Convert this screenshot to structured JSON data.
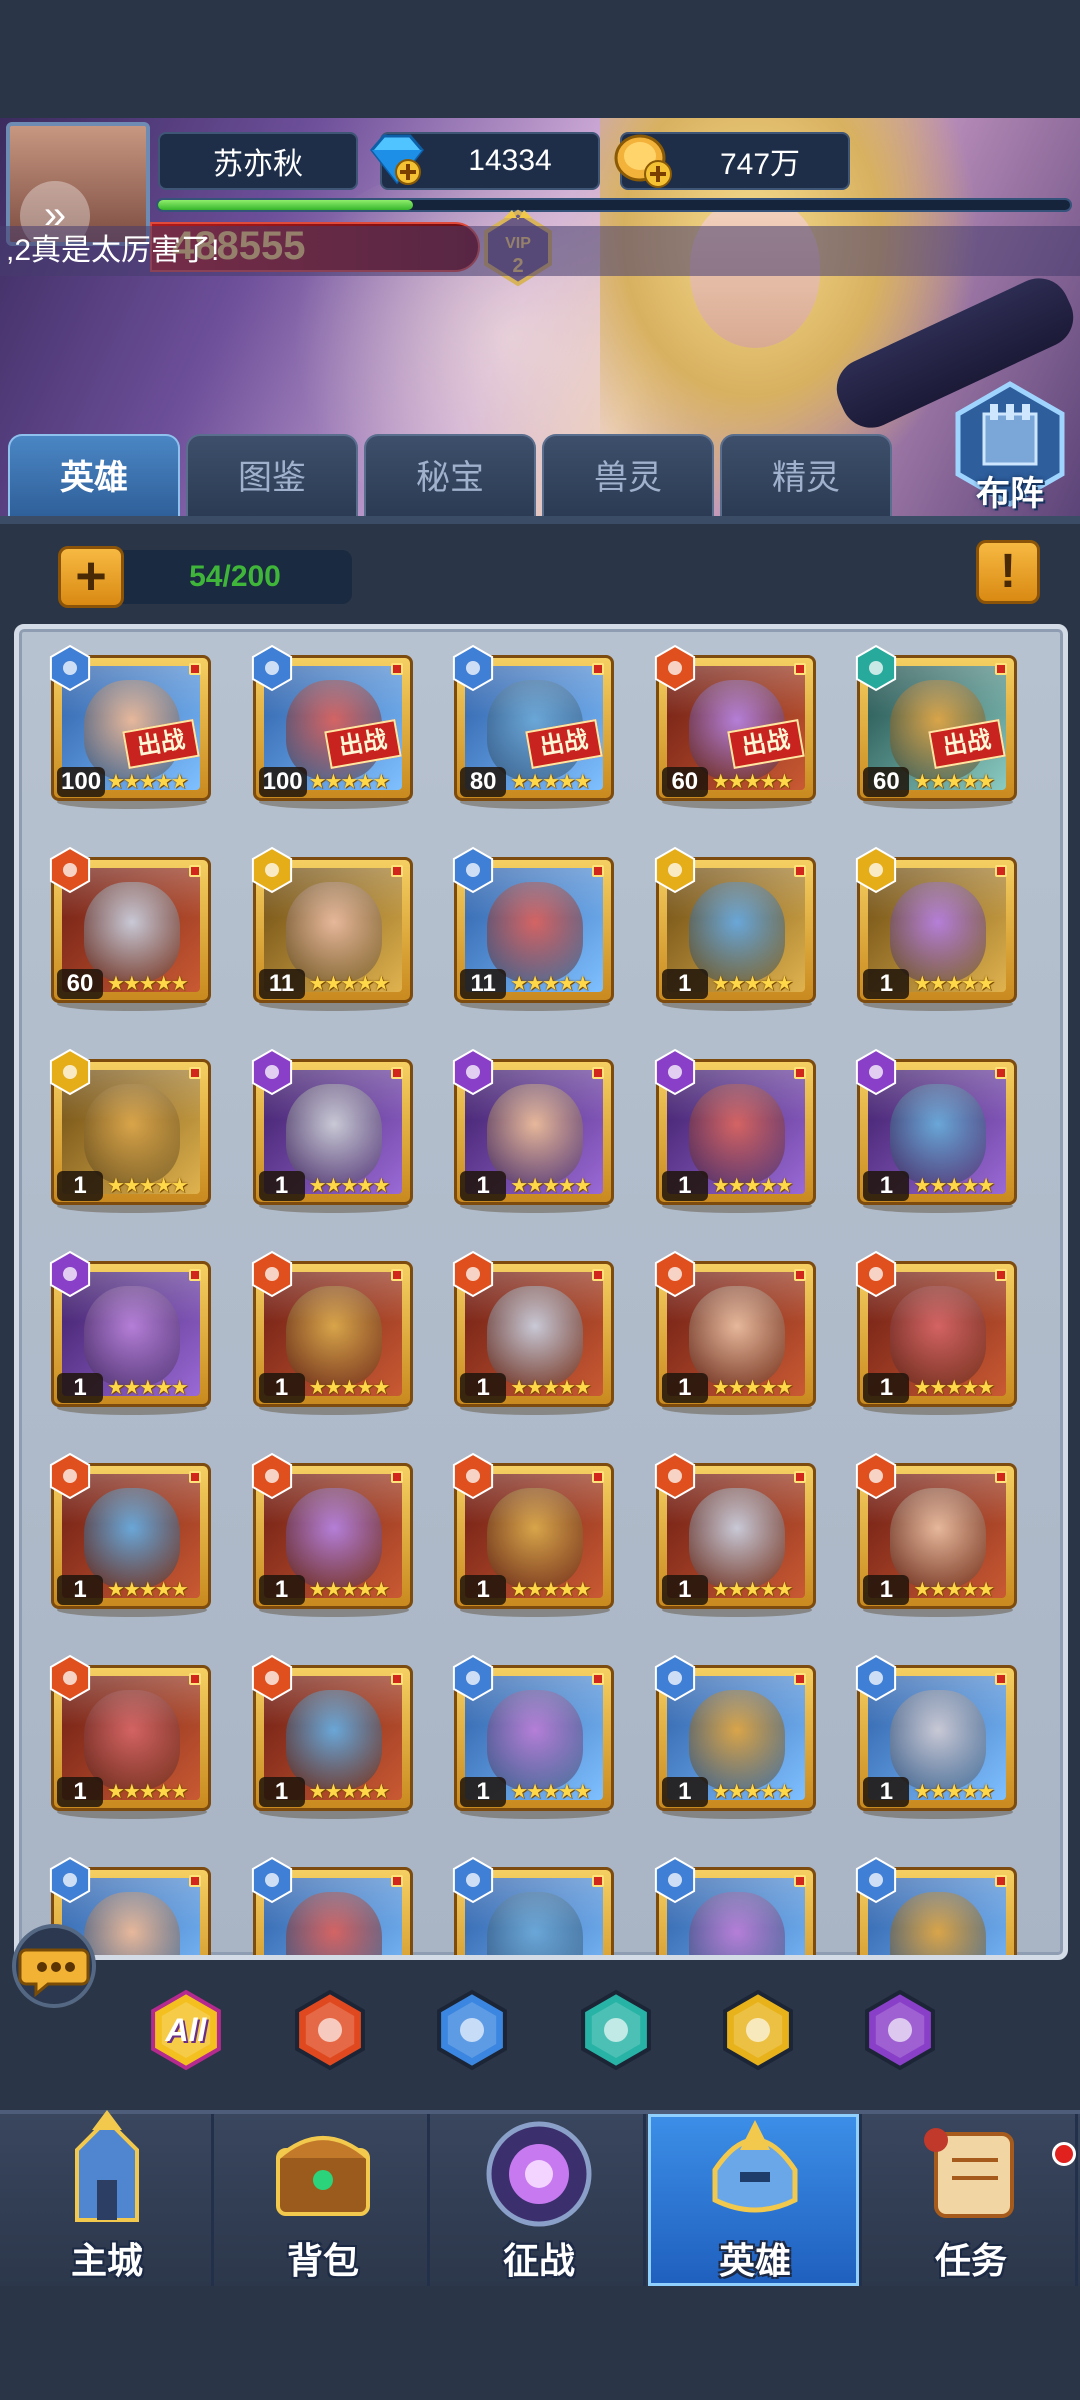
{
  "player": {
    "name": "苏亦秋",
    "diamonds": "14334",
    "gold": "747万",
    "power": "488555",
    "vip_level": "2",
    "xp_progress": 0.28
  },
  "chat_ticker": ",2真是太厉害了!",
  "formation_label": "布阵",
  "tabs": [
    {
      "label": "英雄",
      "active": true
    },
    {
      "label": "图鉴",
      "active": false
    },
    {
      "label": "秘宝",
      "active": false
    },
    {
      "label": "兽灵",
      "active": false
    },
    {
      "label": "精灵",
      "active": false
    }
  ],
  "inventory": {
    "count": "54/200",
    "add_label": "+",
    "info_label": "!"
  },
  "deploy_label": "出战",
  "heroes": [
    {
      "level": "100",
      "faction": "blue",
      "stars": 5,
      "deployed": true
    },
    {
      "level": "100",
      "faction": "blue",
      "stars": 5,
      "deployed": true
    },
    {
      "level": "80",
      "faction": "blue",
      "stars": 5,
      "deployed": true
    },
    {
      "level": "60",
      "faction": "red",
      "stars": 5,
      "deployed": true
    },
    {
      "level": "60",
      "faction": "teal",
      "stars": 5,
      "deployed": true
    },
    {
      "level": "60",
      "faction": "red",
      "stars": 5,
      "deployed": false
    },
    {
      "level": "11",
      "faction": "yellow",
      "stars": 5,
      "deployed": false
    },
    {
      "level": "11",
      "faction": "blue",
      "stars": 5,
      "deployed": false
    },
    {
      "level": "1",
      "faction": "yellow",
      "stars": 5,
      "deployed": false
    },
    {
      "level": "1",
      "faction": "yellow",
      "stars": 5,
      "deployed": false
    },
    {
      "level": "1",
      "faction": "yellow",
      "stars": 5,
      "deployed": false
    },
    {
      "level": "1",
      "faction": "purple",
      "stars": 5,
      "deployed": false
    },
    {
      "level": "1",
      "faction": "purple",
      "stars": 5,
      "deployed": false
    },
    {
      "level": "1",
      "faction": "purple",
      "stars": 5,
      "deployed": false
    },
    {
      "level": "1",
      "faction": "purple",
      "stars": 5,
      "deployed": false
    },
    {
      "level": "1",
      "faction": "purple",
      "stars": 5,
      "deployed": false
    },
    {
      "level": "1",
      "faction": "red",
      "stars": 5,
      "deployed": false
    },
    {
      "level": "1",
      "faction": "red",
      "stars": 5,
      "deployed": false
    },
    {
      "level": "1",
      "faction": "red",
      "stars": 5,
      "deployed": false
    },
    {
      "level": "1",
      "faction": "red",
      "stars": 5,
      "deployed": false
    },
    {
      "level": "1",
      "faction": "red",
      "stars": 5,
      "deployed": false
    },
    {
      "level": "1",
      "faction": "red",
      "stars": 5,
      "deployed": false
    },
    {
      "level": "1",
      "faction": "red",
      "stars": 5,
      "deployed": false
    },
    {
      "level": "1",
      "faction": "red",
      "stars": 5,
      "deployed": false
    },
    {
      "level": "1",
      "faction": "red",
      "stars": 5,
      "deployed": false
    },
    {
      "level": "1",
      "faction": "red",
      "stars": 5,
      "deployed": false
    },
    {
      "level": "1",
      "faction": "red",
      "stars": 5,
      "deployed": false
    },
    {
      "level": "1",
      "faction": "blue",
      "stars": 5,
      "deployed": false
    },
    {
      "level": "1",
      "faction": "blue",
      "stars": 5,
      "deployed": false
    },
    {
      "level": "1",
      "faction": "blue",
      "stars": 5,
      "deployed": false
    },
    {
      "level": "",
      "faction": "blue",
      "stars": 0,
      "deployed": false
    },
    {
      "level": "",
      "faction": "blue",
      "stars": 0,
      "deployed": false
    },
    {
      "level": "",
      "faction": "blue",
      "stars": 0,
      "deployed": false
    },
    {
      "level": "",
      "faction": "blue",
      "stars": 0,
      "deployed": false
    },
    {
      "level": "",
      "faction": "blue",
      "stars": 0,
      "deployed": false
    }
  ],
  "filters": [
    {
      "id": "all",
      "label": "All",
      "color": "#f4c020"
    },
    {
      "id": "fire",
      "label": "",
      "color": "#e0491f"
    },
    {
      "id": "water",
      "label": "",
      "color": "#3b86e0"
    },
    {
      "id": "undead",
      "label": "",
      "color": "#27b3a5"
    },
    {
      "id": "light",
      "label": "",
      "color": "#e8b21a"
    },
    {
      "id": "dark",
      "label": "",
      "color": "#8a3fc8"
    }
  ],
  "nav": [
    {
      "label": "主城",
      "icon": "castle-icon",
      "active": false
    },
    {
      "label": "背包",
      "icon": "treasure-chest-icon",
      "active": false
    },
    {
      "label": "征战",
      "icon": "dragon-portal-icon",
      "active": false
    },
    {
      "label": "英雄",
      "icon": "hero-helmet-icon",
      "active": true
    },
    {
      "label": "任务",
      "icon": "scroll-icon",
      "active": false
    }
  ],
  "colors": {
    "faction_blue": "#3f7fd6",
    "faction_red": "#e0501e",
    "faction_teal": "#27a99b",
    "faction_yellow": "#e5ad17",
    "faction_purple": "#8a3fc8",
    "card_gold": "#e6b040",
    "count_green": "#3fb63a"
  }
}
